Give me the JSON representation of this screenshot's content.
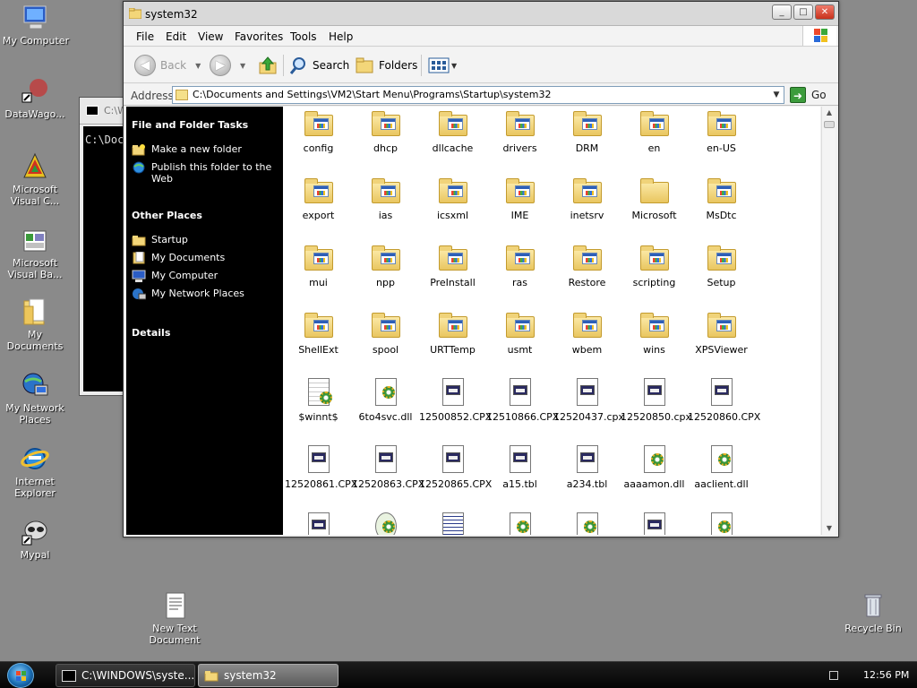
{
  "desktop": {
    "icons": [
      {
        "label": "My Computer"
      },
      {
        "label": "DataWago..."
      },
      {
        "label": "Microsoft Visual C..."
      },
      {
        "label": "Microsoft Visual Ba..."
      },
      {
        "label": "My Documents"
      },
      {
        "label": "My Network Places"
      },
      {
        "label": "Internet Explorer"
      },
      {
        "label": "Mypal"
      },
      {
        "label": "New Text Document"
      },
      {
        "label": "Recycle Bin"
      }
    ]
  },
  "console": {
    "title": "C:\\WIN...",
    "text": "C:\\Doc"
  },
  "window": {
    "title": "system32",
    "buttons": {
      "minimize": "_",
      "maximize": "□",
      "close": "✕"
    },
    "menu": [
      "File",
      "Edit",
      "View",
      "Favorites",
      "Tools",
      "Help"
    ],
    "toolbar": {
      "back": "Back",
      "search": "Search",
      "folders": "Folders"
    },
    "address": {
      "label": "Address",
      "value": "C:\\Documents and Settings\\VM2\\Start Menu\\Programs\\Startup\\system32",
      "go": "Go"
    },
    "taskpane": {
      "file_tasks_title": "File and Folder Tasks",
      "file_tasks": [
        "Make a new folder",
        "Publish this folder to the Web"
      ],
      "other_places_title": "Other Places",
      "other_places": [
        "Startup",
        "My Documents",
        "My Computer",
        "My Network Places"
      ],
      "details_title": "Details"
    },
    "items": [
      {
        "name": "config",
        "kind": "folder"
      },
      {
        "name": "dhcp",
        "kind": "folder"
      },
      {
        "name": "dllcache",
        "kind": "folder"
      },
      {
        "name": "drivers",
        "kind": "folder"
      },
      {
        "name": "DRM",
        "kind": "folder"
      },
      {
        "name": "en",
        "kind": "folder"
      },
      {
        "name": "en-US",
        "kind": "folder"
      },
      {
        "name": "export",
        "kind": "folder"
      },
      {
        "name": "ias",
        "kind": "folder"
      },
      {
        "name": "icsxml",
        "kind": "folder"
      },
      {
        "name": "IME",
        "kind": "folder"
      },
      {
        "name": "inetsrv",
        "kind": "folder"
      },
      {
        "name": "Microsoft",
        "kind": "folder-plain"
      },
      {
        "name": "MsDtc",
        "kind": "folder"
      },
      {
        "name": "mui",
        "kind": "folder"
      },
      {
        "name": "npp",
        "kind": "folder"
      },
      {
        "name": "PreInstall",
        "kind": "folder"
      },
      {
        "name": "ras",
        "kind": "folder"
      },
      {
        "name": "Restore",
        "kind": "folder"
      },
      {
        "name": "scripting",
        "kind": "folder"
      },
      {
        "name": "Setup",
        "kind": "folder"
      },
      {
        "name": "ShellExt",
        "kind": "folder"
      },
      {
        "name": "spool",
        "kind": "folder"
      },
      {
        "name": "URTTemp",
        "kind": "folder"
      },
      {
        "name": "usmt",
        "kind": "folder"
      },
      {
        "name": "wbem",
        "kind": "folder"
      },
      {
        "name": "wins",
        "kind": "folder"
      },
      {
        "name": "XPSViewer",
        "kind": "folder"
      },
      {
        "name": "$winnt$",
        "kind": "ini"
      },
      {
        "name": "6to4svc.dll",
        "kind": "dll"
      },
      {
        "name": "12500852.CPX",
        "kind": "file"
      },
      {
        "name": "12510866.CPX",
        "kind": "file"
      },
      {
        "name": "12520437.cpx",
        "kind": "file"
      },
      {
        "name": "12520850.cpx",
        "kind": "file"
      },
      {
        "name": "12520860.CPX",
        "kind": "file"
      },
      {
        "name": "12520861.CPX",
        "kind": "file"
      },
      {
        "name": "12520863.CPX",
        "kind": "file"
      },
      {
        "name": "12520865.CPX",
        "kind": "file"
      },
      {
        "name": "a15.tbl",
        "kind": "file"
      },
      {
        "name": "a234.tbl",
        "kind": "file"
      },
      {
        "name": "aaaamon.dll",
        "kind": "dll"
      },
      {
        "name": "aaclient.dll",
        "kind": "dll"
      },
      {
        "name": "",
        "kind": "file"
      },
      {
        "name": "",
        "kind": "exe"
      },
      {
        "name": "",
        "kind": "doc"
      },
      {
        "name": "",
        "kind": "dll"
      },
      {
        "name": "",
        "kind": "dll"
      },
      {
        "name": "",
        "kind": "file"
      },
      {
        "name": "",
        "kind": "dll"
      }
    ]
  },
  "taskbar": {
    "tasks": [
      "C:\\WINDOWS\\syste...",
      "system32"
    ],
    "clock": "12:56 PM"
  }
}
